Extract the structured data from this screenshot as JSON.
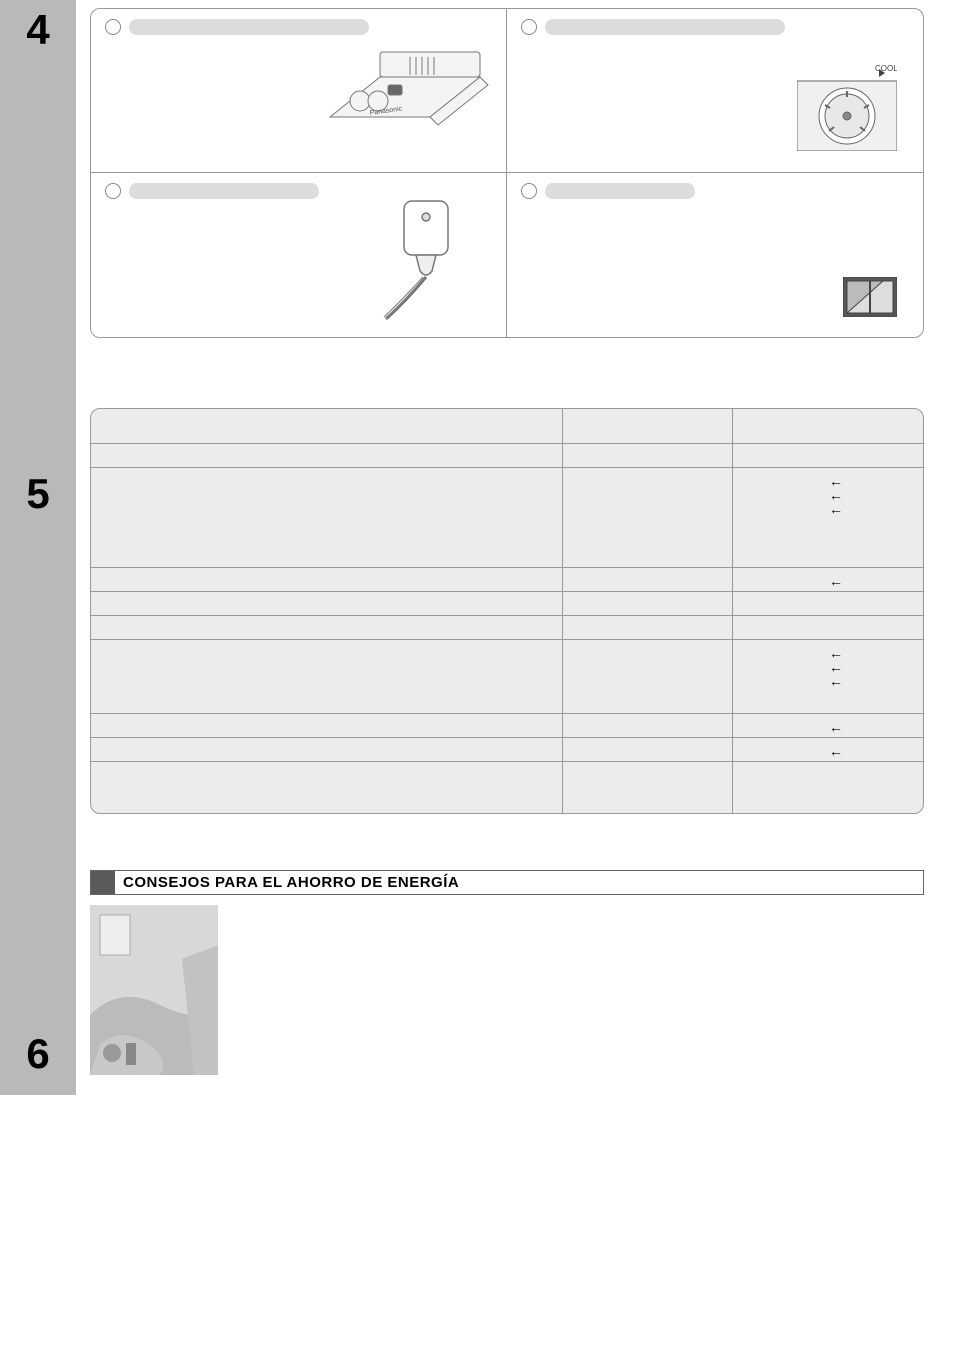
{
  "sidebar": {
    "sections": [
      "4",
      "5",
      "6"
    ]
  },
  "section4": {
    "q1": "",
    "q2": "",
    "q3": "",
    "q4": "",
    "label_on_illus": "COOLER"
  },
  "section5": {
    "arrows": [
      "←",
      "←",
      "←",
      "←",
      "←",
      "←",
      "←",
      "←",
      "←"
    ]
  },
  "section6": {
    "heading": "CONSEJOS PARA EL AHORRO DE ENERGÍA"
  }
}
